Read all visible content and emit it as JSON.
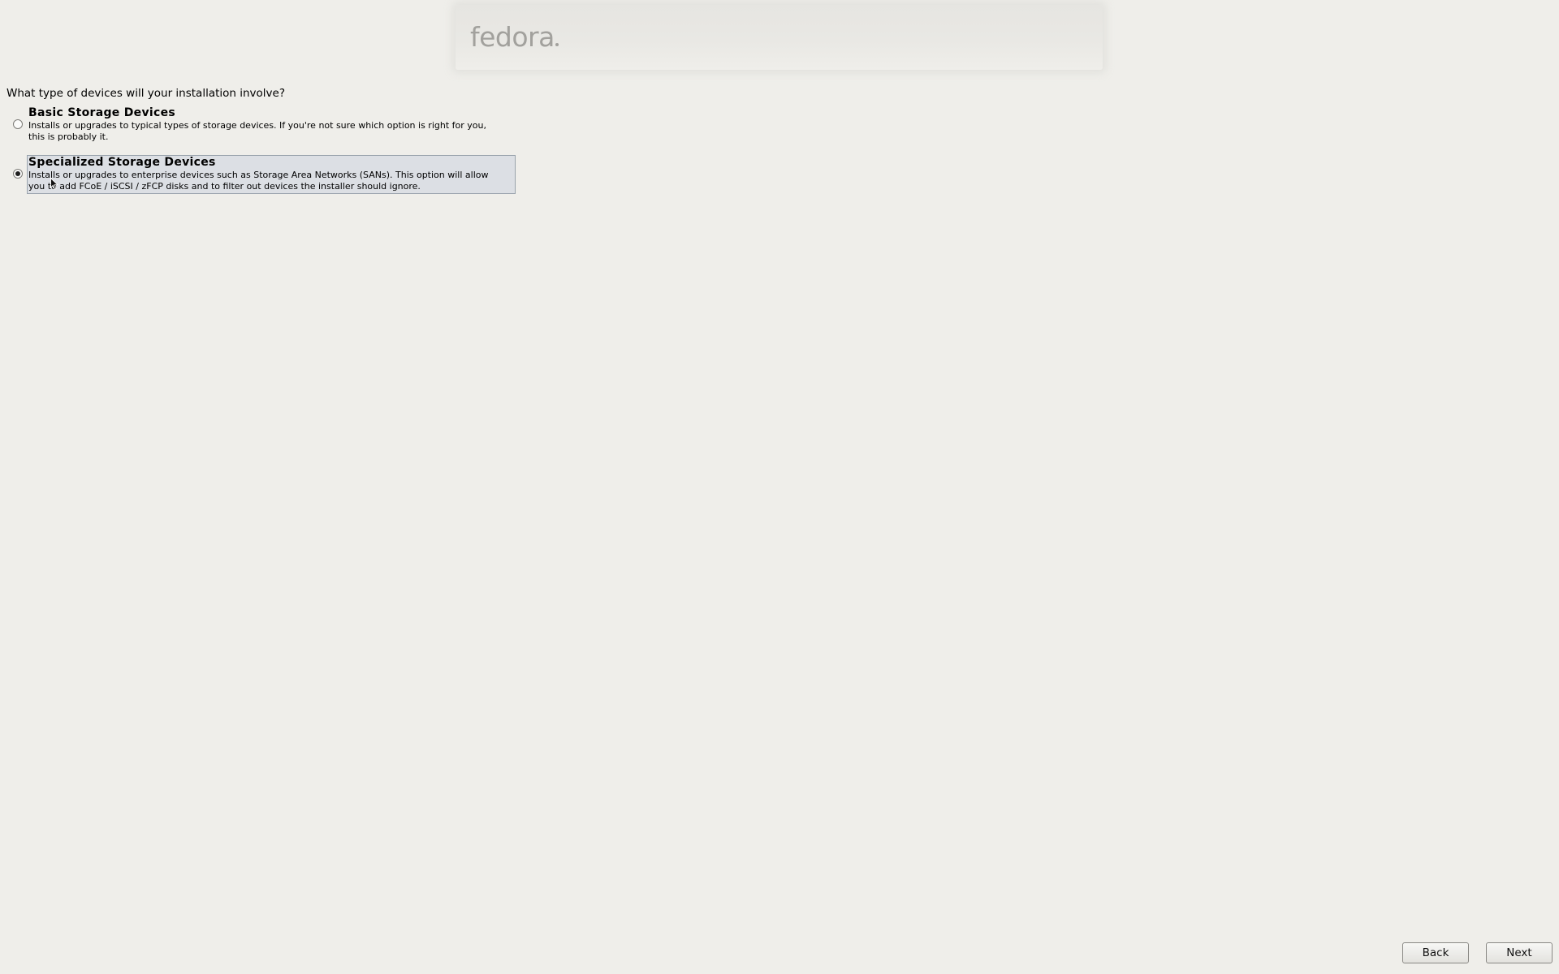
{
  "banner": {
    "logo_text": "fedora"
  },
  "question": "What type of devices will your installation involve?",
  "options": [
    {
      "title": "Basic Storage Devices",
      "description": "Installs or upgrades to typical types of storage devices.  If you're not sure which option is right for you,\nthis is probably it.",
      "selected": false
    },
    {
      "title": "Specialized Storage Devices",
      "description": "Installs or upgrades to enterprise devices such as Storage Area Networks (SANs). This option will allow\nyou to add FCoE / iSCSI / zFCP disks and to filter out devices the installer should ignore.",
      "selected": true
    }
  ],
  "buttons": {
    "back_label": "Back",
    "next_label": "Next"
  },
  "icons": {
    "selected_radio": "radio-checked-icon",
    "unselected_radio": "radio-unchecked-icon",
    "cursor": "mouse-cursor-icon"
  }
}
